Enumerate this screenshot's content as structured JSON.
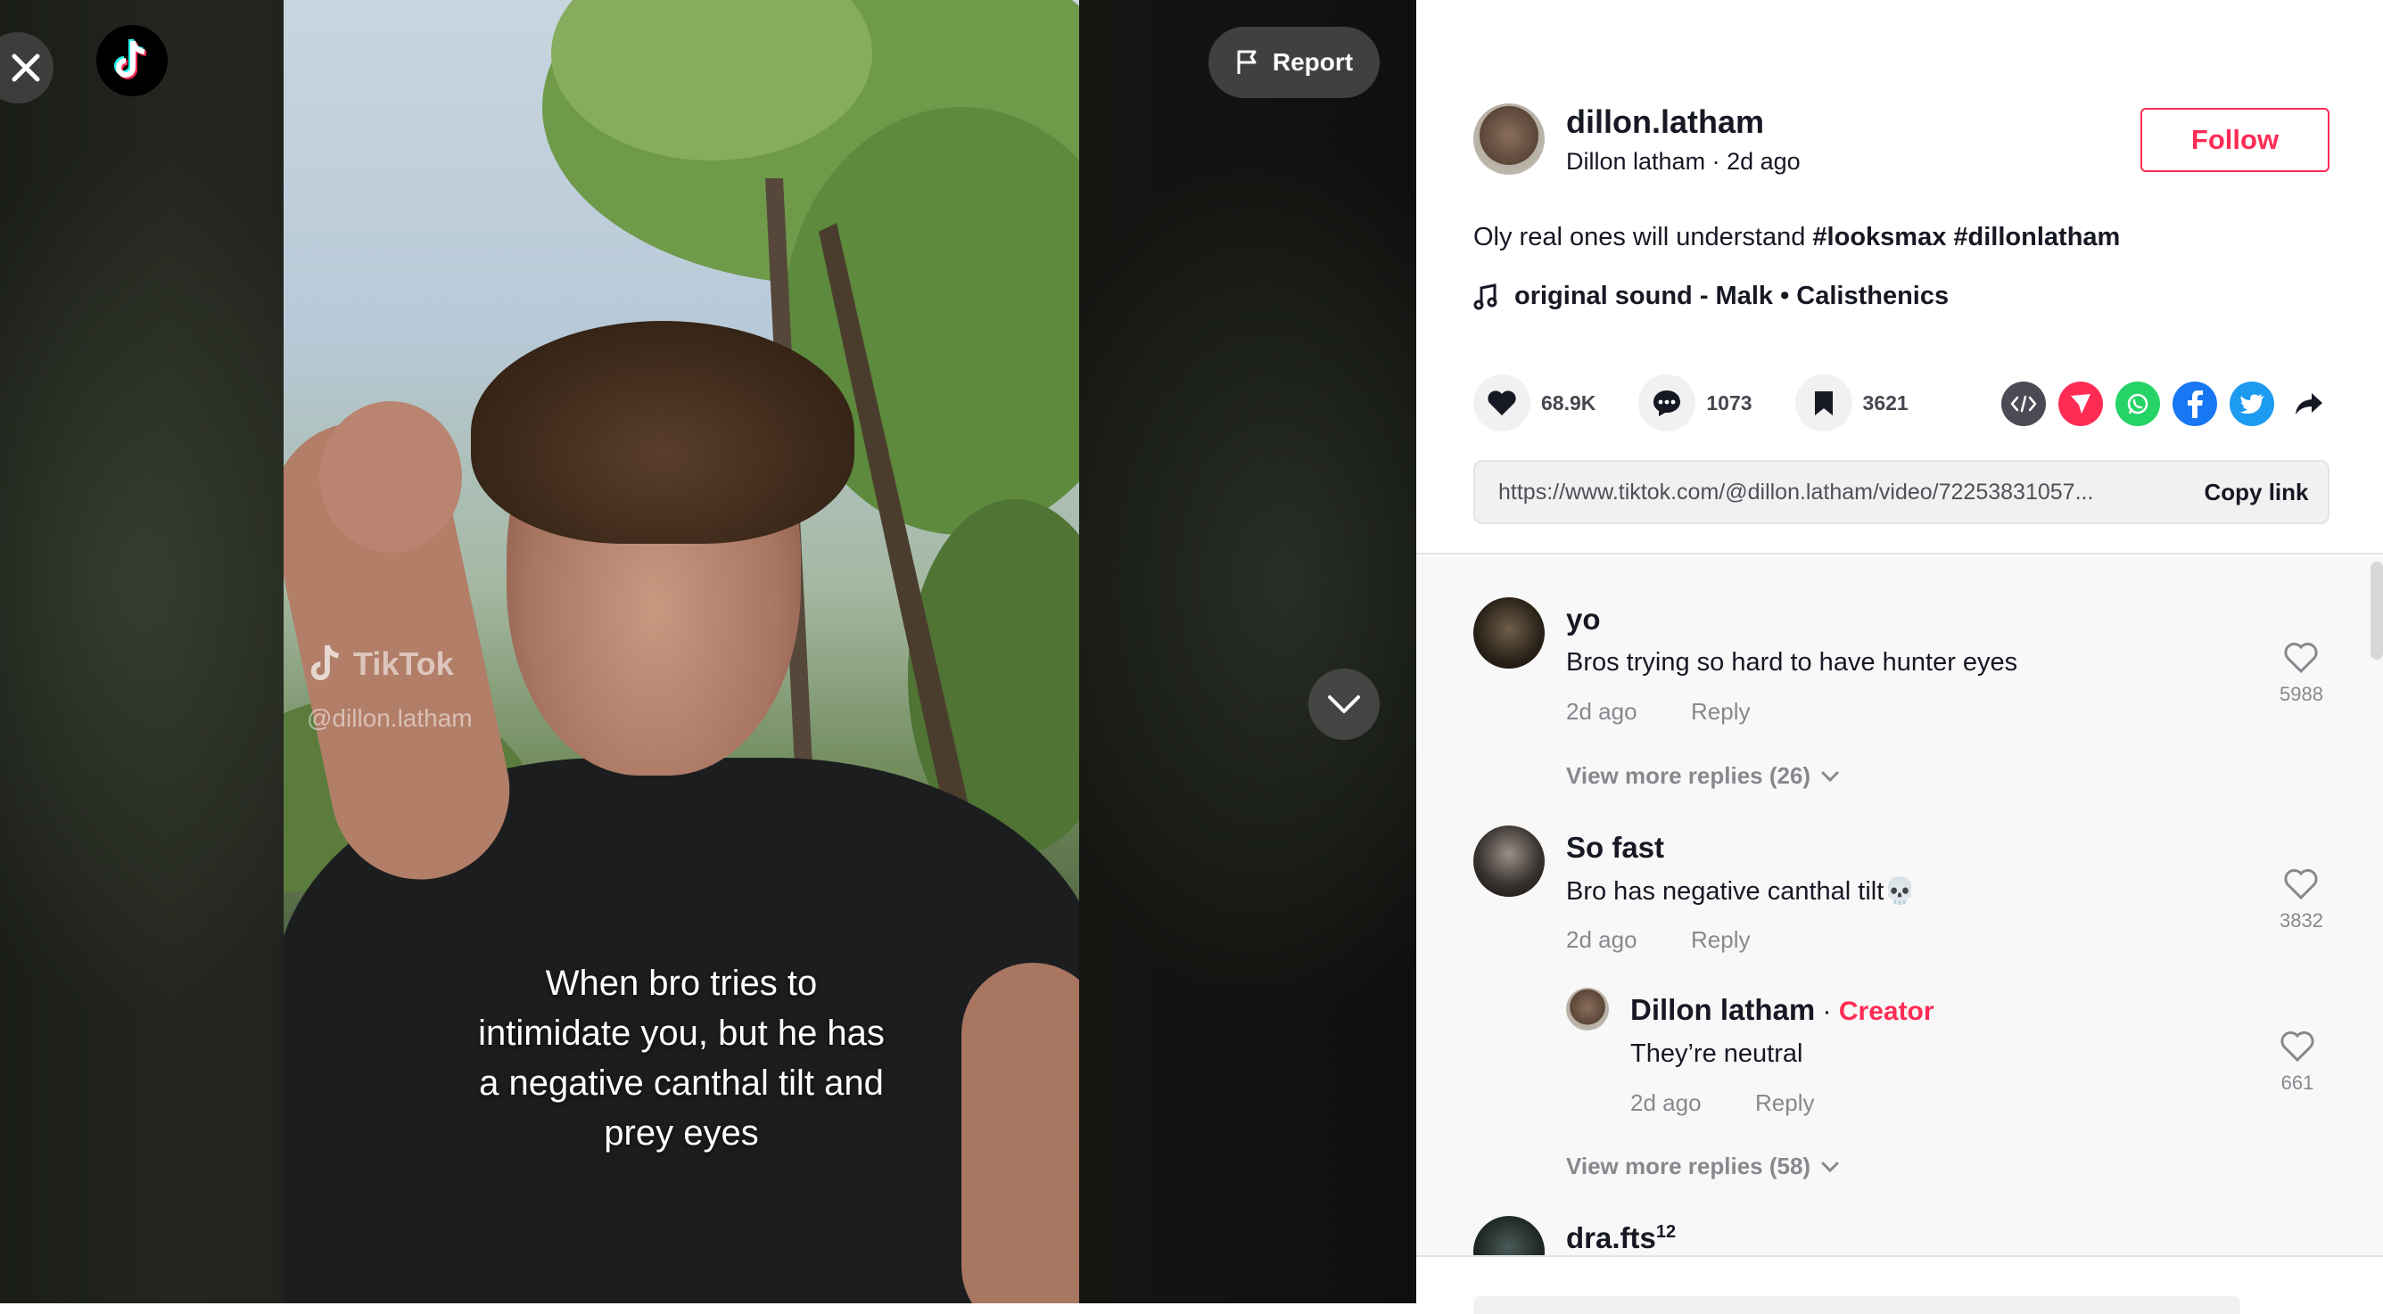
{
  "player": {
    "report_label": "Report",
    "watermark_brand": "TikTok",
    "watermark_handle": "@dillon.latham",
    "caption_lines": [
      "When bro tries to",
      "intimidate you, but he has",
      "a negative canthal tilt and",
      "prey eyes"
    ]
  },
  "author": {
    "username": "dillon.latham",
    "display_name": "Dillon latham",
    "separator": " · ",
    "posted": "2d ago",
    "follow_label": "Follow"
  },
  "post": {
    "description_text": "Oly real ones will understand ",
    "hashtags": [
      "#looksmax",
      "#dillonlatham"
    ],
    "music": "original sound - Malk • Calisthenics"
  },
  "stats": {
    "likes": "68.9K",
    "comments": "1073",
    "saves": "3621"
  },
  "share_icons": [
    "embed-icon",
    "send-icon",
    "whatsapp-icon",
    "facebook-icon",
    "twitter-icon",
    "share-arrow-icon"
  ],
  "link": {
    "url": "https://www.tiktok.com/@dillon.latham/video/72253831057...",
    "copy_label": "Copy link"
  },
  "colors": {
    "accent": "#fe2c55",
    "whatsapp": "#25d366",
    "facebook": "#1877f2",
    "twitter": "#1d9bf0",
    "send": "#fe2c55",
    "embed": "#4b4b55"
  },
  "comments": [
    {
      "user": "yo",
      "text": "Bros trying so hard to have hunter eyes",
      "time": "2d ago",
      "reply_label": "Reply",
      "likes": "5988",
      "view_more": "View more replies (26)"
    },
    {
      "user": "So fast",
      "text": "Bro has negative canthal tilt💀",
      "time": "2d ago",
      "reply_label": "Reply",
      "likes": "3832",
      "reply": {
        "user": "Dillon latham",
        "dot": " · ",
        "badge": "Creator",
        "text": "They’re neutral",
        "time": "2d ago",
        "reply_label": "Reply",
        "likes": "661"
      },
      "view_more": "View more replies (58)"
    },
    {
      "user": "dra.fts",
      "superscript": "12"
    }
  ]
}
